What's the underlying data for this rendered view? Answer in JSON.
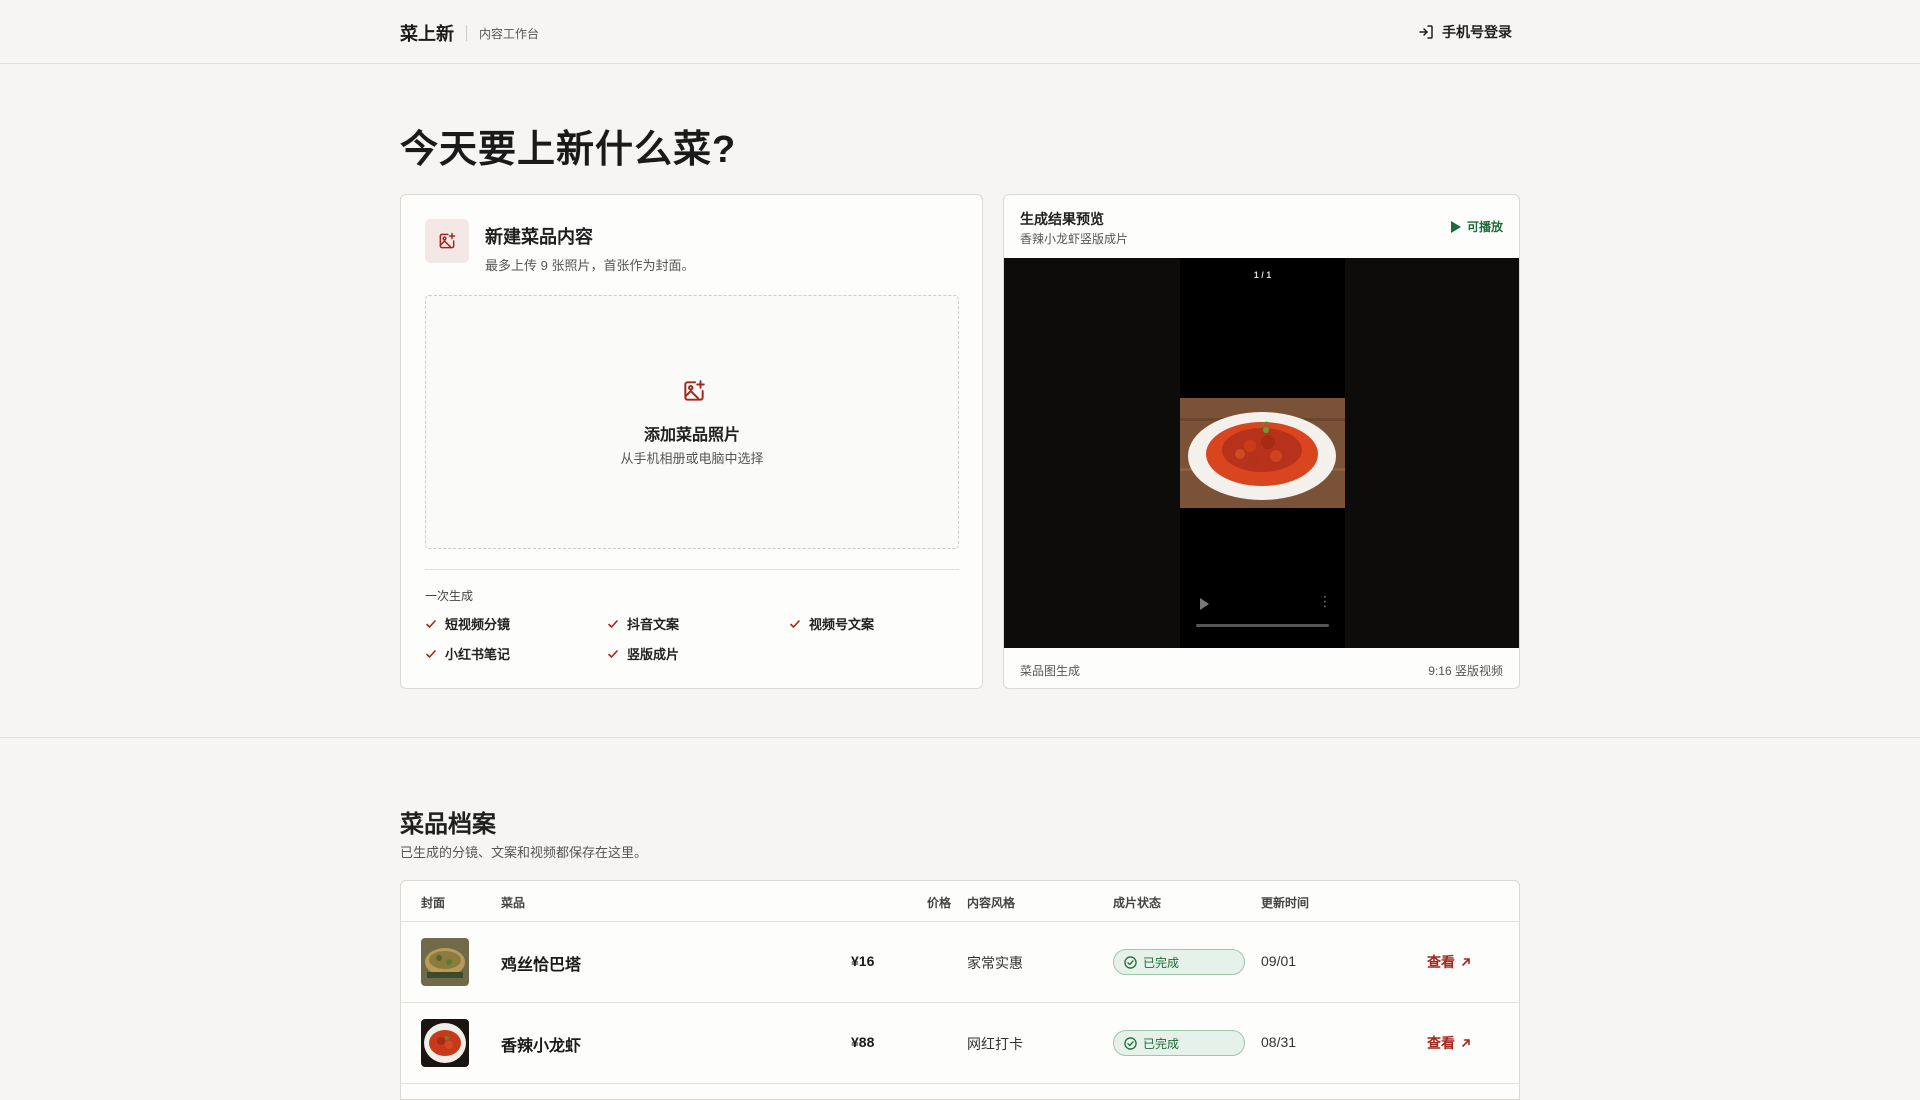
{
  "header": {
    "brand": "菜上新",
    "subtitle": "内容工作台",
    "login_label": "手机号登录",
    "login_icon": "login-icon"
  },
  "hero": {
    "title": "今天要上新什么菜?"
  },
  "upload_card": {
    "title": "新建菜品内容",
    "description": "最多上传 9 张照片，首张作为封面。",
    "dropzone_title": "添加菜品照片",
    "dropzone_subtitle": "从手机相册或电脑中选择",
    "generate_label": "一次生成",
    "outputs": [
      "短视频分镜",
      "抖音文案",
      "视频号文案",
      "小红书笔记",
      "竖版成片"
    ],
    "accent_color": "#a3271d"
  },
  "preview_card": {
    "title": "生成结果预览",
    "subtitle": "香辣小龙虾竖版成片",
    "play_label": "可播放",
    "counter": "1 / 1",
    "footer_left": "菜品图生成",
    "footer_right": "9:16 竖版视频",
    "play_color": "#1d6b3a"
  },
  "archive": {
    "title": "菜品档案",
    "description": "已生成的分镜、文案和视频都保存在这里。",
    "columns": [
      "封面",
      "菜品",
      "价格",
      "内容风格",
      "成片状态",
      "更新时间"
    ],
    "rows": [
      {
        "name": "鸡丝恰巴塔",
        "price": "¥16",
        "style": "家常实惠",
        "status": "已完成",
        "updated": "09/01",
        "action": "查看"
      },
      {
        "name": "香辣小龙虾",
        "price": "¥88",
        "style": "网红打卡",
        "status": "已完成",
        "updated": "08/31",
        "action": "查看"
      }
    ],
    "status_color": "#1d6b3a"
  }
}
